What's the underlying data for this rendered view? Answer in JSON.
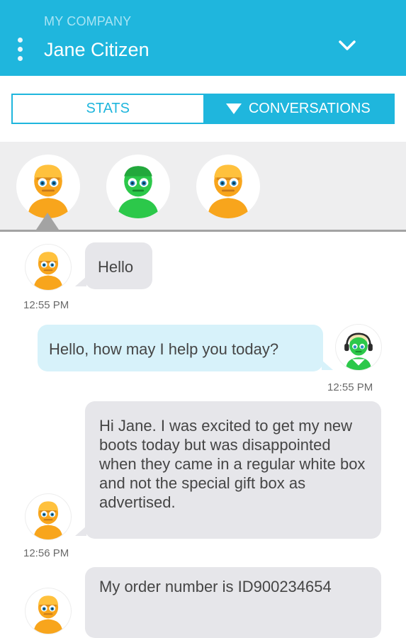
{
  "header": {
    "company": "MY COMPANY",
    "user_name": "Jane Citizen",
    "menu_icon": "more-vertical-icon",
    "dropdown_icon": "chevron-down-icon"
  },
  "tabs": {
    "stats_label": "STATS",
    "conversations_label": "CONVERSATIONS",
    "active": "CONVERSATIONS"
  },
  "colors": {
    "accent": "#1fb6dd",
    "incoming_bubble": "#e6e6ea",
    "outgoing_bubble": "#d7f2fa",
    "customer_avatar": "#f8a51c",
    "green_avatar": "#2cc84a"
  },
  "conversation_avatars": [
    "customer-orange-avatar",
    "customer-green-avatar",
    "customer-orange-avatar"
  ],
  "messages": [
    {
      "from": "customer",
      "text": "Hello",
      "time": "12:55 PM"
    },
    {
      "from": "agent",
      "text": "Hello, how may I help you today?",
      "time": "12:55 PM"
    },
    {
      "from": "customer",
      "text": "Hi Jane. I was excited to get my new boots today but was disappointed when they came in a regular white box and not the special gift box as advertised.",
      "time": "12:56 PM"
    },
    {
      "from": "customer",
      "text": "My order number is ID900234654",
      "time": ""
    }
  ]
}
